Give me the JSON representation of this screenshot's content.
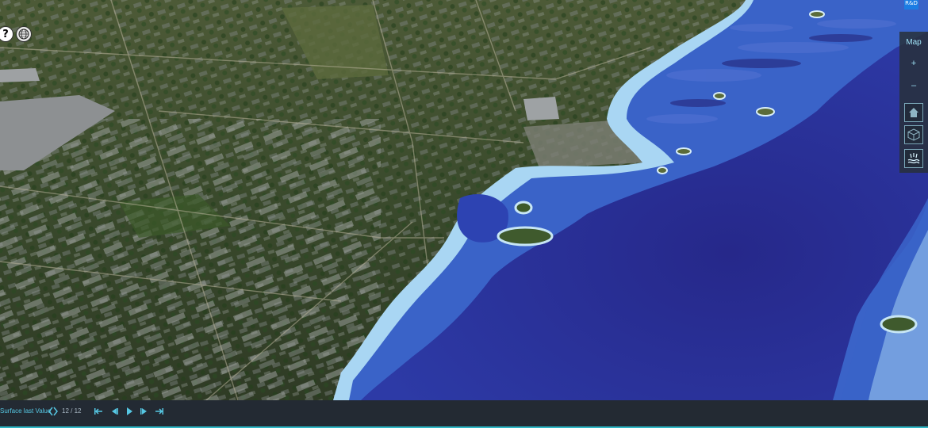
{
  "toolbar": {
    "help_label": "?",
    "brand_chip": "R&D",
    "map_label": "Map",
    "zoom_in_label": "+",
    "zoom_out_label": "–",
    "icons": [
      "home-icon",
      "cube-3d-icon",
      "layers-icon"
    ]
  },
  "timeline": {
    "layer_label": "Surface last Value",
    "counter": "12 / 12",
    "controls": [
      "skip-to-start-icon",
      "step-back-icon",
      "play-icon",
      "step-forward-icon",
      "skip-to-end-icon"
    ]
  },
  "colors": {
    "water_deep": "#2a2f93",
    "water_shallow": "#2b4fb8",
    "shore_band": "#9fd0f2",
    "accent_cyan": "#2fb7c6",
    "toolbar_bg": "#28303a"
  }
}
